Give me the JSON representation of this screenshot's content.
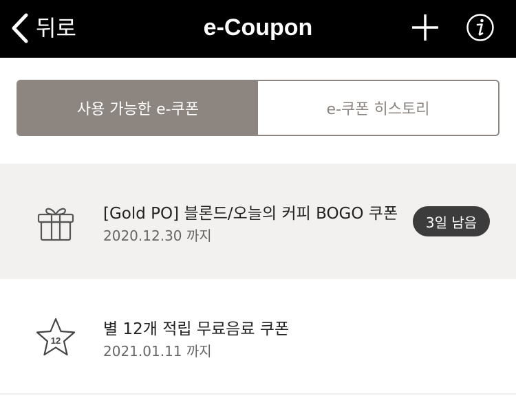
{
  "header": {
    "back_label": "뒤로",
    "title": "e-Coupon",
    "icons": {
      "back": "chevron-left-icon",
      "add": "plus-icon",
      "info": "info-icon"
    }
  },
  "tabs": [
    {
      "label": "사용 가능한 e-쿠폰",
      "active": true
    },
    {
      "label": "e-쿠폰 히스토리",
      "active": false
    }
  ],
  "coupons": [
    {
      "icon": "gift-icon",
      "name": "[Gold PO] 블론드/오늘의 커피 BOGO 쿠폰",
      "date": "2020.12.30 까지",
      "badge": "3일 남음"
    },
    {
      "icon": "star-icon",
      "icon_number": "12",
      "name": "별 12개 적립 무료음료 쿠폰",
      "date": "2021.01.11 까지"
    }
  ],
  "colors": {
    "header_bg": "#000000",
    "tab_active": "#8c8580",
    "badge_bg": "#3c3c3c",
    "row_highlight": "#f2f1f0"
  }
}
